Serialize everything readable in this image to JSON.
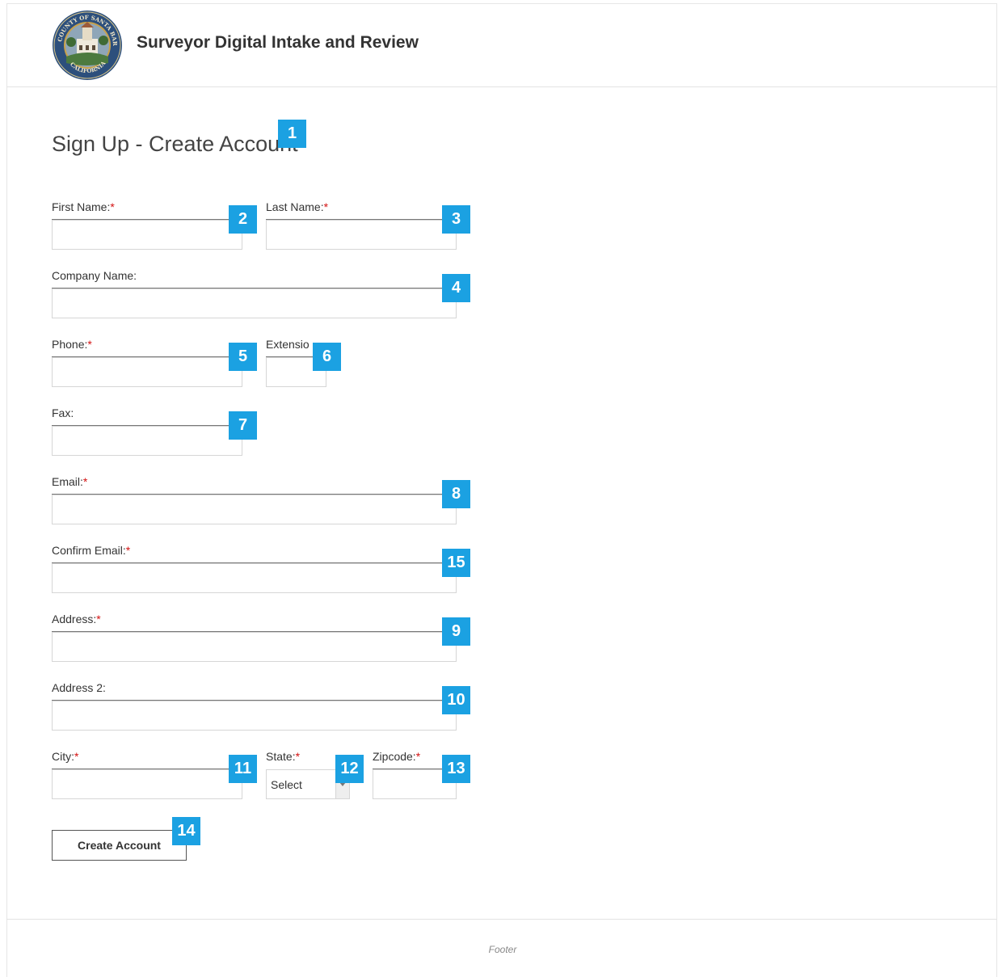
{
  "header": {
    "app_title": "Surveyor Digital Intake and Review",
    "seal_text": "COUNTY OF SANTA BARBARA CALIFORNIA"
  },
  "page": {
    "title": "Sign Up - Create Account"
  },
  "form": {
    "required_marker": "*",
    "first_name_label": "First Name:",
    "last_name_label": "Last Name:",
    "company_name_label": "Company Name:",
    "phone_label": "Phone:",
    "extension_label": "Extensio",
    "fax_label": "Fax:",
    "email_label": "Email:",
    "confirm_email_label": "Confirm Email:",
    "address_label": "Address:",
    "address2_label": "Address 2:",
    "city_label": "City:",
    "state_label": "State:",
    "state_value": "Select",
    "zipcode_label": "Zipcode:",
    "submit_label": "Create Account"
  },
  "badges": {
    "b1": "1",
    "b2": "2",
    "b3": "3",
    "b4": "4",
    "b5": "5",
    "b6": "6",
    "b7": "7",
    "b8": "8",
    "b15": "15",
    "b9": "9",
    "b10": "10",
    "b11": "11",
    "b12": "12",
    "b13": "13",
    "b14": "14"
  },
  "footer": {
    "text": "Footer"
  },
  "colors": {
    "badge": "#1ba1e2",
    "required": "#d31111"
  }
}
